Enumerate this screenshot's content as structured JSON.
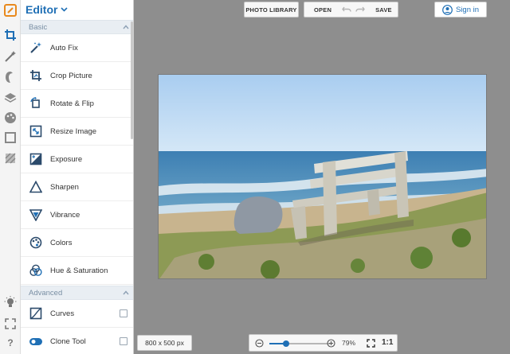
{
  "panel": {
    "title": "Editor",
    "sections": {
      "basic": "Basic",
      "advanced": "Advanced"
    },
    "basic_tools": [
      {
        "label": "Auto Fix",
        "icon": "magic-wand-icon"
      },
      {
        "label": "Crop Picture",
        "icon": "crop-icon"
      },
      {
        "label": "Rotate & Flip",
        "icon": "rotate-icon"
      },
      {
        "label": "Resize Image",
        "icon": "resize-icon"
      },
      {
        "label": "Exposure",
        "icon": "exposure-icon"
      },
      {
        "label": "Sharpen",
        "icon": "sharpen-icon"
      },
      {
        "label": "Vibrance",
        "icon": "vibrance-icon"
      },
      {
        "label": "Colors",
        "icon": "palette-icon"
      },
      {
        "label": "Hue & Saturation",
        "icon": "hue-saturation-icon"
      }
    ],
    "advanced_tools": [
      {
        "label": "Curves",
        "icon": "curves-icon"
      },
      {
        "label": "Clone Tool",
        "icon": "clone-icon"
      }
    ]
  },
  "toolbar": {
    "photo_library": "PHOTO LIBRARY",
    "open": "OPEN",
    "save": "SAVE",
    "sign_in": "Sign in"
  },
  "footer": {
    "dimensions": "800 x 500 px",
    "zoom": "79%",
    "zoom_level": 0.28,
    "one_to_one": "1:1"
  },
  "colors": {
    "accent": "#1f6fb5",
    "canvas": "#8e8e8e"
  }
}
